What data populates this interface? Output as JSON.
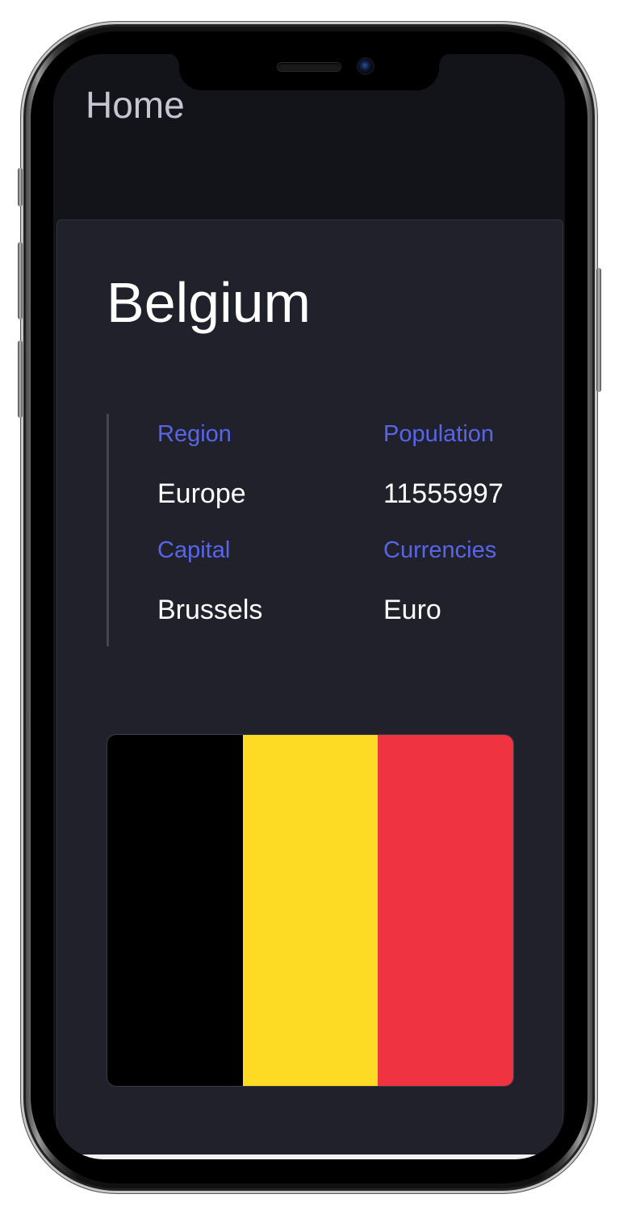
{
  "header": {
    "title": "Home"
  },
  "country": {
    "name": "Belgium",
    "fields": [
      {
        "label": "Region",
        "value": "Europe"
      },
      {
        "label": "Population",
        "value": "11555997"
      },
      {
        "label": "Capital",
        "value": "Brussels"
      },
      {
        "label": "Currencies",
        "value": "Euro"
      }
    ],
    "flag": {
      "stripes": [
        "#000000",
        "#FDDA24",
        "#EF3340"
      ]
    }
  },
  "colors": {
    "background": "#13141a",
    "card": "#20212a",
    "label_accent": "#5865e8"
  }
}
